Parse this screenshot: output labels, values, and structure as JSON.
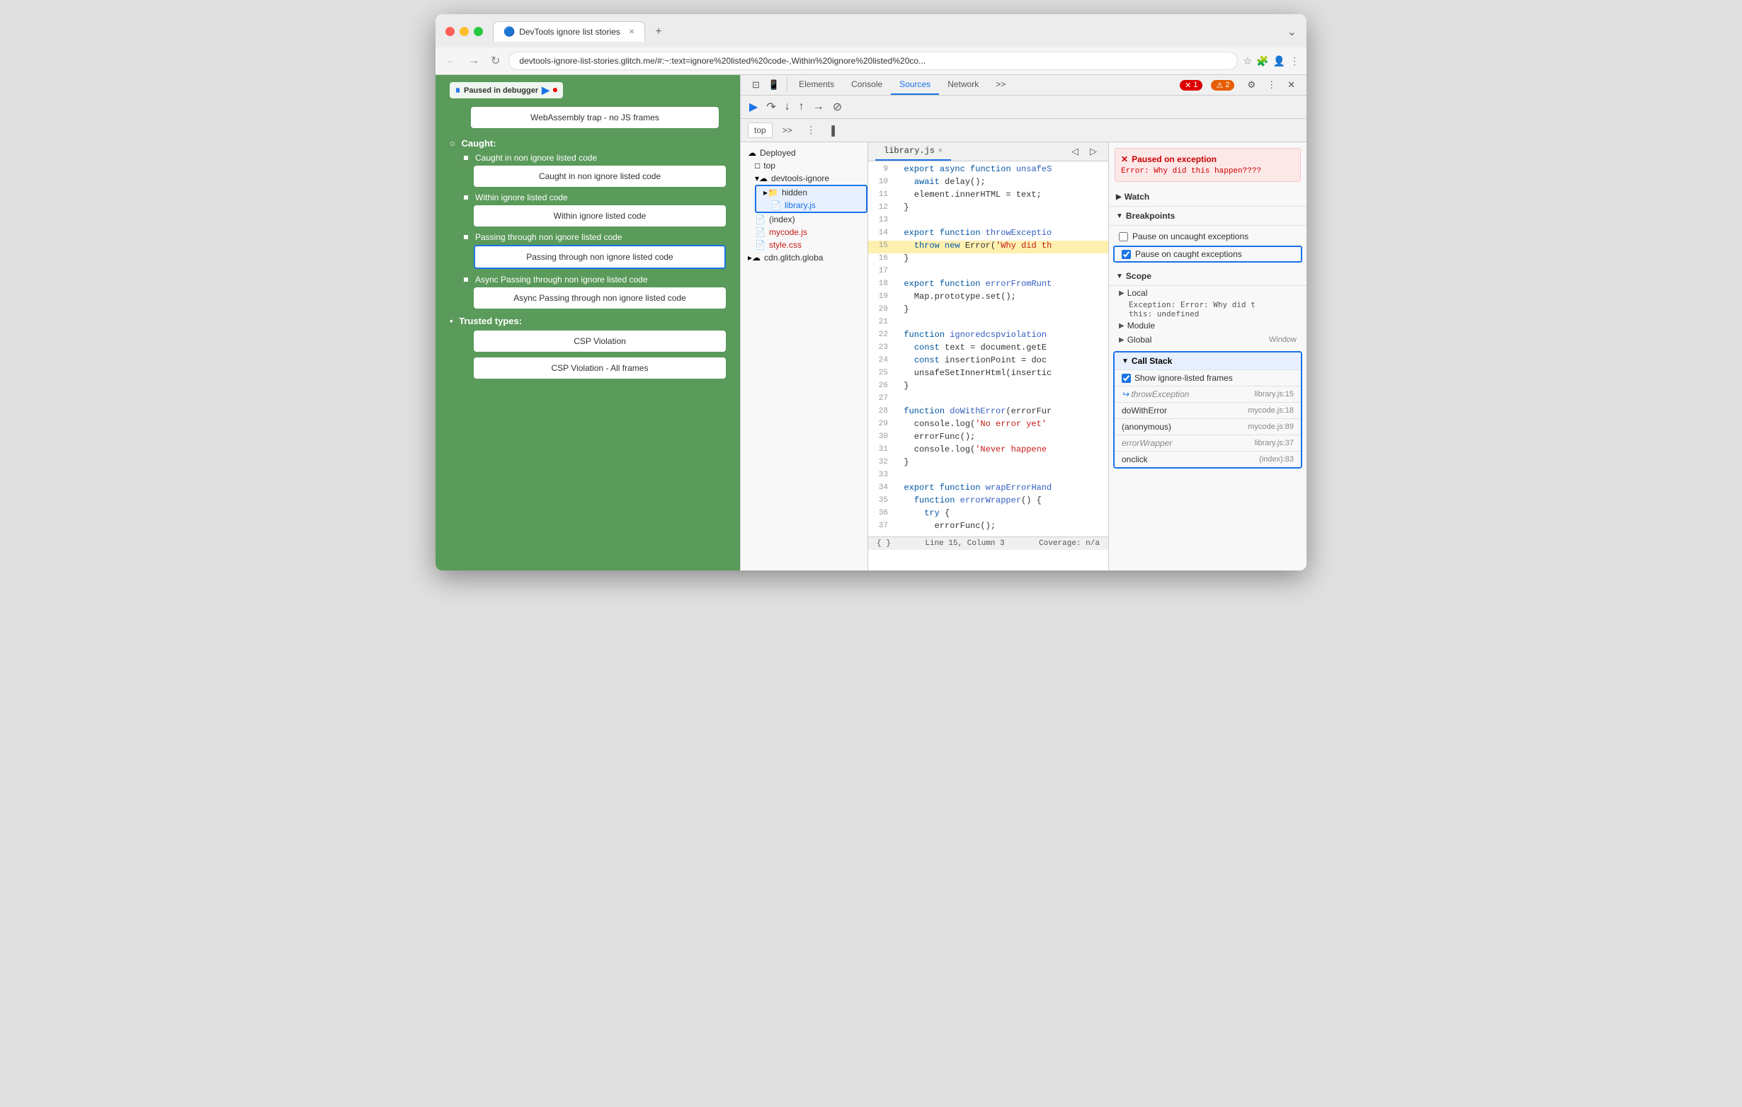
{
  "browser": {
    "tab_title": "DevTools ignore list stories",
    "tab_icon": "🔵",
    "url": "devtools-ignore-list-stories.glitch.me/#:~:text=ignore%20listed%20code-,Within%20ignore%20listed%20co...",
    "paused_badge": "Paused in debugger"
  },
  "page_content": {
    "wasm_box": "WebAssembly trap - no JS frames",
    "caught_label": "Caught:",
    "items": [
      {
        "label": "Caught in non ignore listed code",
        "box_text": "Caught in non ignore listed code",
        "active": false
      },
      {
        "label": "Within ignore listed code",
        "box_text": "Within ignore listed code",
        "active": false
      },
      {
        "label": "Passing through non ignore listed code",
        "box_text": "Passing through non ignore listed code",
        "active": true
      },
      {
        "label": "Async Passing through non ignore listed code",
        "box_text": "Async Passing through non ignore listed code",
        "active": false
      }
    ],
    "trusted_types_label": "Trusted types:",
    "csp_items": [
      "CSP Violation",
      "CSP Violation - All frames"
    ]
  },
  "devtools": {
    "tabs": [
      "Elements",
      "Console",
      "Sources",
      "Network",
      ">>"
    ],
    "active_tab": "Sources",
    "error_count": "1",
    "warn_count": "2",
    "file_tree": {
      "deployed_label": "Deployed",
      "top_label": "top",
      "devtools_ignore_label": "devtools-ignore",
      "hidden_folder": "hidden",
      "library_file": "library.js",
      "index_file": "(index)",
      "mycode_file": "mycode.js",
      "style_file": "style.css",
      "cdn_label": "cdn.glitch.globa"
    },
    "source_tab": "library.js",
    "code_lines": [
      {
        "num": "9",
        "content": "  export async function unsafeS",
        "highlight": false,
        "throw": false
      },
      {
        "num": "10",
        "content": "    await delay();",
        "highlight": false,
        "throw": false
      },
      {
        "num": "11",
        "content": "    element.innerHTML = text;",
        "highlight": false,
        "throw": false
      },
      {
        "num": "12",
        "content": "}",
        "highlight": false,
        "throw": false
      },
      {
        "num": "13",
        "content": "",
        "highlight": false,
        "throw": false
      },
      {
        "num": "14",
        "content": "  export function throwExceptio",
        "highlight": false,
        "throw": false
      },
      {
        "num": "15",
        "content": "    throw new Error('Why did th",
        "highlight": false,
        "throw": true
      },
      {
        "num": "16",
        "content": "}",
        "highlight": false,
        "throw": false
      },
      {
        "num": "17",
        "content": "",
        "highlight": false,
        "throw": false
      },
      {
        "num": "18",
        "content": "  export function errorFromRunt",
        "highlight": false,
        "throw": false
      },
      {
        "num": "19",
        "content": "    Map.prototype.set();",
        "highlight": false,
        "throw": false
      },
      {
        "num": "20",
        "content": "}",
        "highlight": false,
        "throw": false
      },
      {
        "num": "21",
        "content": "",
        "highlight": false,
        "throw": false
      },
      {
        "num": "22",
        "content": "  function ignoredcspviolation",
        "highlight": false,
        "throw": false
      },
      {
        "num": "23",
        "content": "    const text = document.getE",
        "highlight": false,
        "throw": false
      },
      {
        "num": "24",
        "content": "    const insertionPoint = doc",
        "highlight": false,
        "throw": false
      },
      {
        "num": "25",
        "content": "    unsafeSetInnerHtml(insertic",
        "highlight": false,
        "throw": false
      },
      {
        "num": "26",
        "content": "}",
        "highlight": false,
        "throw": false
      },
      {
        "num": "27",
        "content": "",
        "highlight": false,
        "throw": false
      },
      {
        "num": "28",
        "content": "  function doWithError(errorFur",
        "highlight": false,
        "throw": false
      },
      {
        "num": "29",
        "content": "    console.log('No error yet'",
        "highlight": false,
        "throw": false
      },
      {
        "num": "30",
        "content": "    errorFunc();",
        "highlight": false,
        "throw": false
      },
      {
        "num": "31",
        "content": "    console.log('Never happene",
        "highlight": false,
        "throw": false
      },
      {
        "num": "32",
        "content": "}",
        "highlight": false,
        "throw": false
      },
      {
        "num": "33",
        "content": "",
        "highlight": false,
        "throw": false
      },
      {
        "num": "34",
        "content": "  export function wrapErrorHand",
        "highlight": false,
        "throw": false
      },
      {
        "num": "35",
        "content": "    function errorWrapper() {",
        "highlight": false,
        "throw": false
      },
      {
        "num": "36",
        "content": "      try {",
        "highlight": false,
        "throw": false
      },
      {
        "num": "37",
        "content": "        errorFunc();",
        "highlight": false,
        "throw": false
      }
    ],
    "status_bar": {
      "left": "{ }",
      "line_col": "Line 15, Column 3",
      "coverage": "Coverage: n/a"
    },
    "right_panel": {
      "exception_title": "Paused on exception",
      "exception_msg": "Error: Why did this\nhappen????",
      "watch_label": "Watch",
      "breakpoints_label": "Breakpoints",
      "pause_uncaught": "Pause on uncaught exceptions",
      "pause_caught": "Pause on caught exceptions",
      "scope_label": "Scope",
      "local_label": "Local",
      "exception_detail": "Exception: Error: Why did t",
      "this_val": "this:  undefined",
      "module_label": "Module",
      "global_label": "Global",
      "global_val": "Window",
      "call_stack_label": "Call Stack",
      "show_ignore_label": "Show ignore-listed frames",
      "call_stack_items": [
        {
          "fn": "throwException",
          "file": "library.js:15",
          "muted": true,
          "icon": true
        },
        {
          "fn": "doWithError",
          "file": "mycode.js:18",
          "muted": false,
          "icon": false
        },
        {
          "fn": "(anonymous)",
          "file": "mycode.js:89",
          "muted": false,
          "icon": false
        },
        {
          "fn": "errorWrapper",
          "file": "library.js:37",
          "muted": true,
          "icon": false
        },
        {
          "fn": "onclick",
          "file": "(index):83",
          "muted": false,
          "icon": false
        }
      ]
    }
  }
}
